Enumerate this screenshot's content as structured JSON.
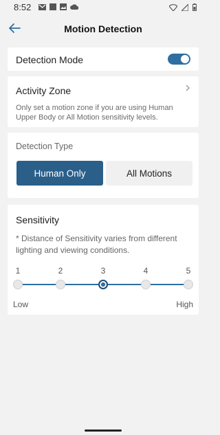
{
  "status_bar": {
    "time": "8:52",
    "left_icons": [
      "gmail-icon",
      "square-icon",
      "image-icon",
      "cloud-icon"
    ],
    "right_icons": [
      "wifi-icon",
      "signal-icon",
      "battery-icon"
    ]
  },
  "header": {
    "title": "Motion Detection",
    "back_icon": "back-arrow-icon"
  },
  "detection_mode": {
    "label": "Detection Mode",
    "enabled": true
  },
  "activity_zone": {
    "label": "Activity Zone",
    "description": "Only set a motion zone if you are using Human Upper Body or All Motion sensitivity levels."
  },
  "detection_type": {
    "title": "Detection Type",
    "options": [
      "Human Only",
      "All Motions"
    ],
    "selected": "Human Only"
  },
  "sensitivity": {
    "title": "Sensitivity",
    "description": "* Distance of Sensitivity varies from different lighting and viewing conditions.",
    "levels": [
      "1",
      "2",
      "3",
      "4",
      "5"
    ],
    "selected_level": 3,
    "low_label": "Low",
    "high_label": "High"
  },
  "colors": {
    "accent": "#2e6ea1",
    "selected_button": "#2a5f8a",
    "background": "#f2f2f3"
  }
}
